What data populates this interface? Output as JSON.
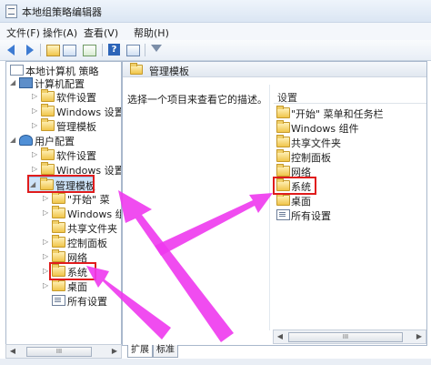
{
  "window": {
    "title": "本地组策略编辑器"
  },
  "menu": [
    "文件(F)",
    "操作(A)",
    "查看(V)",
    "帮助(H)"
  ],
  "toolbar": {
    "buttons": [
      "back-icon",
      "forward-icon",
      "up-folder-icon",
      "show-hide-tree-icon",
      "export-list-icon",
      "help-icon",
      "properties-icon",
      "filter-icon"
    ]
  },
  "tree": {
    "root": "本地计算机 策略",
    "computer_config": "计算机配置",
    "cc_software": "软件设置",
    "cc_windows": "Windows 设置",
    "cc_admin": "管理模板",
    "user_config": "用户配置",
    "uc_software": "软件设置",
    "uc_windows": "Windows 设置",
    "uc_admin": "管理模板",
    "start_menu": "\"开始\" 菜",
    "win_components": "Windows 组件",
    "shared_folders": "共享文件夹",
    "control_panel": "控制面板",
    "network": "网络",
    "system": "系统",
    "desktop": "桌面",
    "all_settings": "所有设置"
  },
  "tree_scroll": {
    "thumb": "III"
  },
  "right": {
    "header": "管理模板",
    "description": "选择一个项目来查看它的描述。",
    "column_header": "设置",
    "items": [
      "\"开始\" 菜单和任务栏",
      "Windows 组件",
      "共享文件夹",
      "控制面板",
      "网络",
      "系统",
      "桌面",
      "所有设置"
    ]
  },
  "right_scroll": {
    "thumb": "III"
  },
  "tabs": [
    "扩展",
    "标准"
  ],
  "colors": {
    "highlight": "#e01c1c",
    "arrow": "#ee39ee",
    "selection": "#cde3f8"
  }
}
